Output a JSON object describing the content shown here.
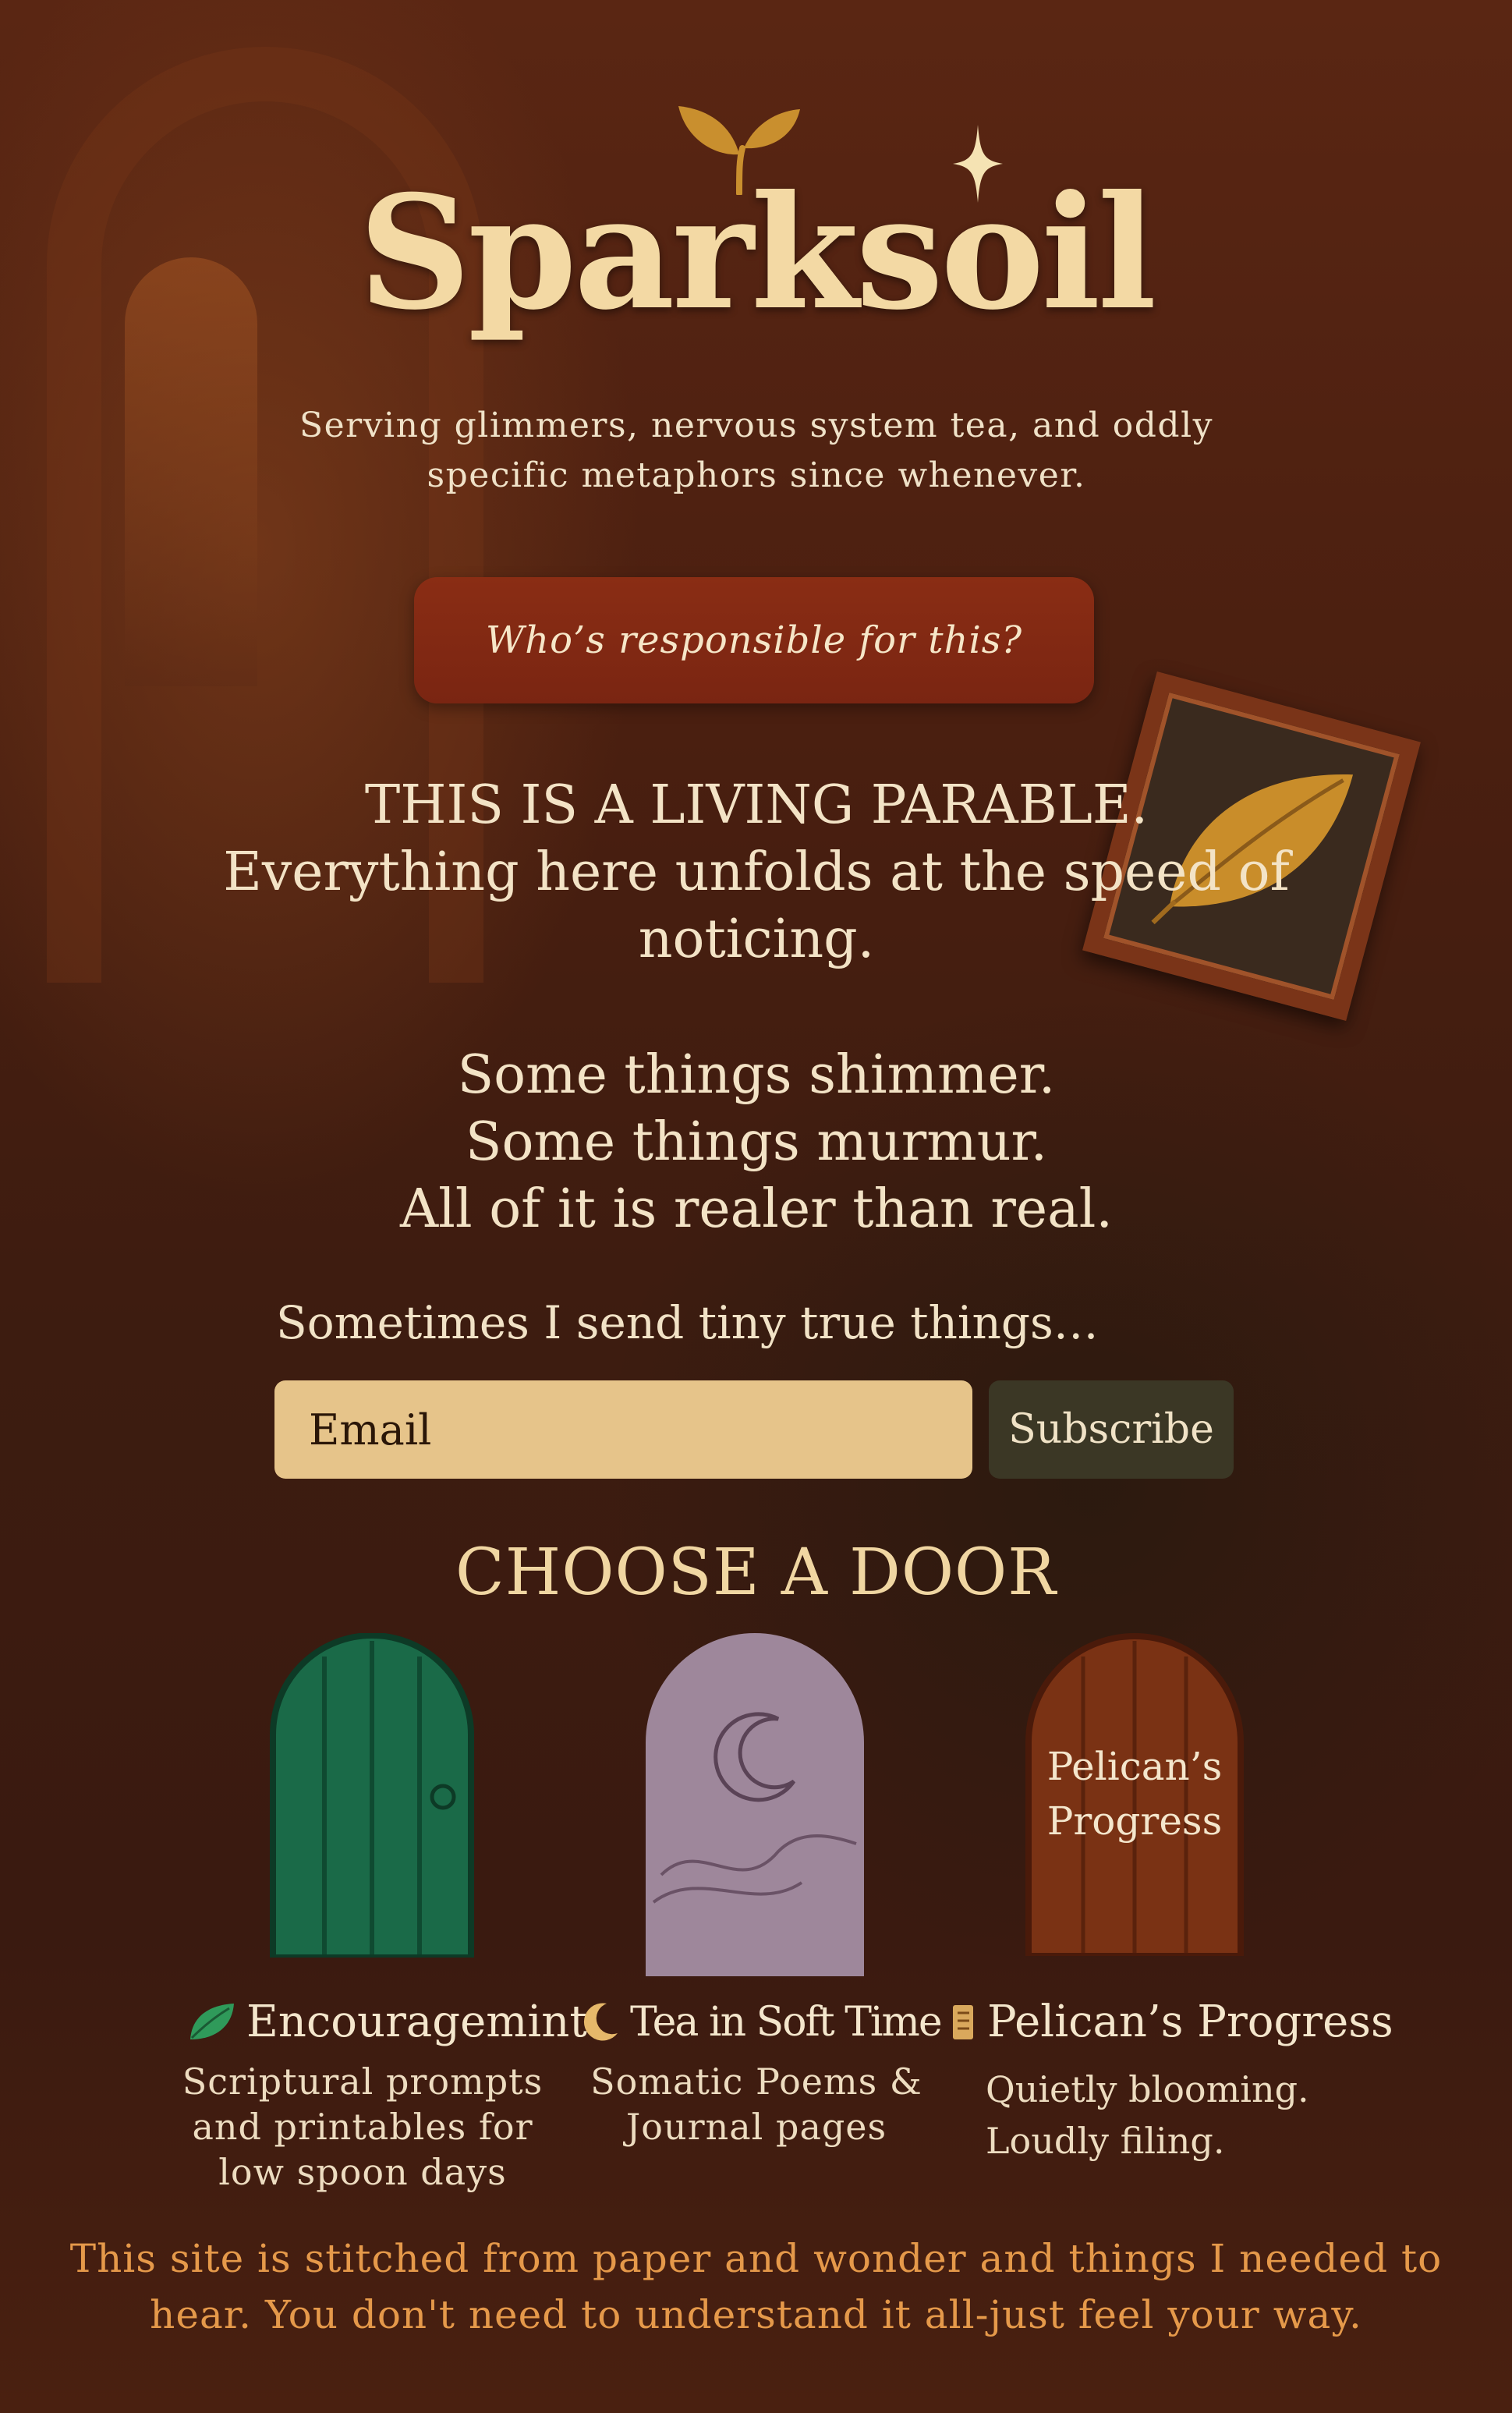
{
  "brand": {
    "name": "Sparksoil",
    "tagline": "Serving glimmers, nervous system tea, and oddly specific metaphors since whenever."
  },
  "about_button": {
    "label": "Who’s responsible for this?"
  },
  "parable": {
    "line1": "THIS IS A LIVING PARABLE.",
    "line2": "Everything here unfolds at the speed of noticing.",
    "line3": "Some things shimmer.",
    "line4": "Some things murmur.",
    "line5": "All of it is realer than real."
  },
  "newsletter": {
    "label": "Sometimes I send tiny true things…",
    "email_placeholder": "Email",
    "subscribe_label": "Subscribe"
  },
  "doors": {
    "heading": "CHOOSE A DOOR",
    "items": [
      {
        "title": "Encouragemint",
        "icon": "leaf-icon",
        "color": "#1a6a48",
        "description": "Scriptural prompts and printables for low spoon days"
      },
      {
        "title": "Tea in Soft Time",
        "icon": "moon-icon",
        "color": "#9e879b",
        "description": "Somatic Poems & Journal pages"
      },
      {
        "title": "Pelican’s Progress",
        "icon": "scroll-icon",
        "color": "#7a3214",
        "door_text": "Pelican’s Progress",
        "description": "Quietly blooming. Loudly filing."
      }
    ]
  },
  "footer": {
    "text": "This site is stitched from paper and wonder and things I needed to hear. You don't need to understand it all-just feel your way."
  },
  "colors": {
    "accent_rust": "#7a2512",
    "title_gold": "#f3d9a4",
    "input_bg": "#e6c48a",
    "footer_orange": "#e5994a"
  }
}
